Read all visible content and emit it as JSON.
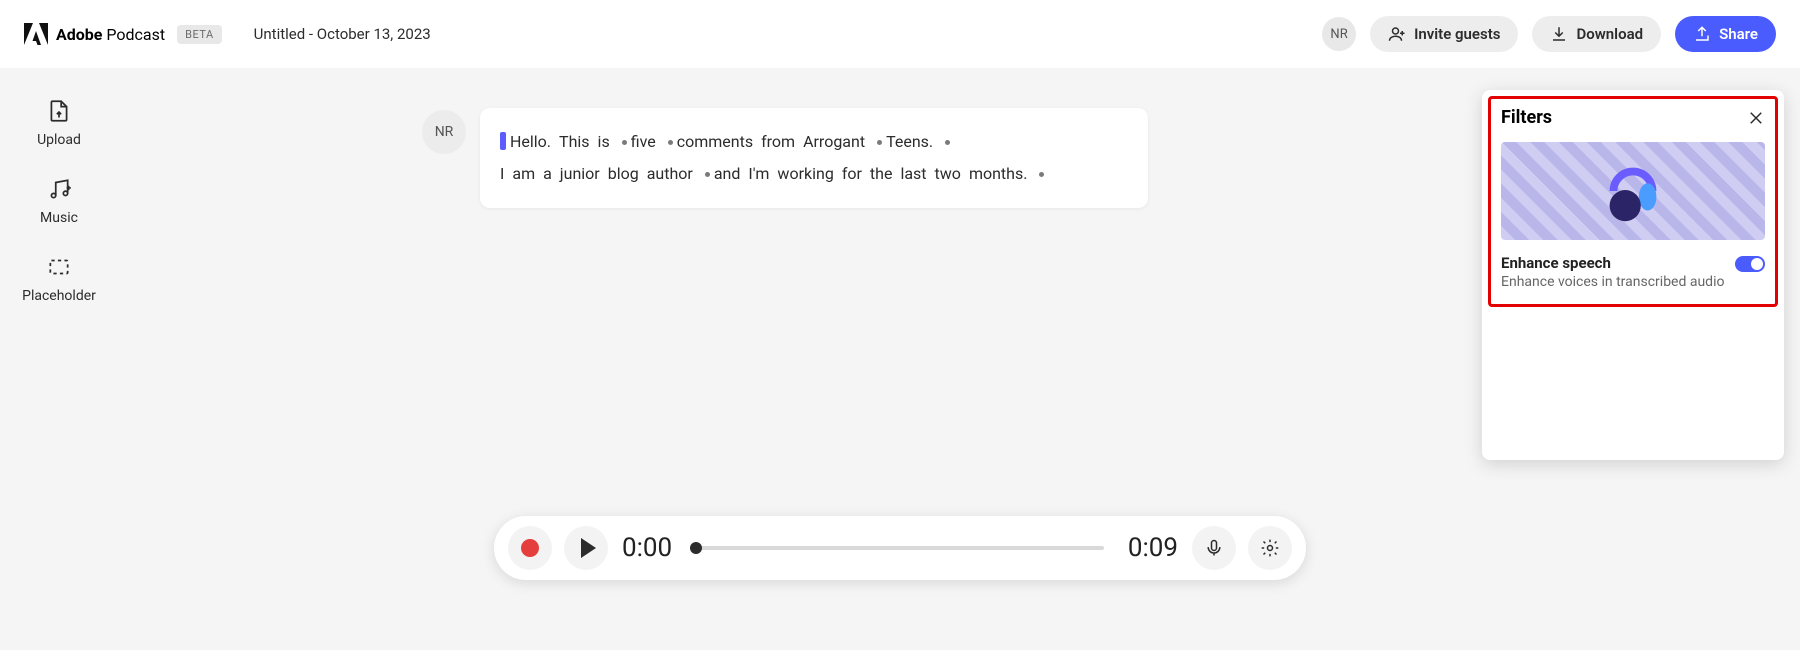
{
  "header": {
    "brand_bold": "Adobe",
    "brand_light": "Podcast",
    "beta": "BETA",
    "doc_title": "Untitled - October 13, 2023",
    "avatar": "NR",
    "invite_label": "Invite guests",
    "download_label": "Download",
    "share_label": "Share"
  },
  "rail": {
    "upload": "Upload",
    "music": "Music",
    "placeholder": "Placeholder"
  },
  "transcript": {
    "speaker": "NR",
    "line1_words": [
      "Hello.",
      "This",
      "is",
      "•",
      "five",
      "•",
      "comments",
      "from",
      "Arrogant",
      "•",
      "Teens.",
      "•"
    ],
    "line2_words": [
      "I",
      "am",
      "a",
      "junior",
      "blog",
      "author",
      "•",
      "and",
      "I'm",
      "working",
      "for",
      "the",
      "last",
      "two",
      "months.",
      "•"
    ]
  },
  "filters": {
    "title": "Filters",
    "enhance_title": "Enhance speech",
    "enhance_desc": "Enhance voices in transcribed audio",
    "toggle_on": true
  },
  "player": {
    "current": "0:00",
    "total": "0:09"
  }
}
